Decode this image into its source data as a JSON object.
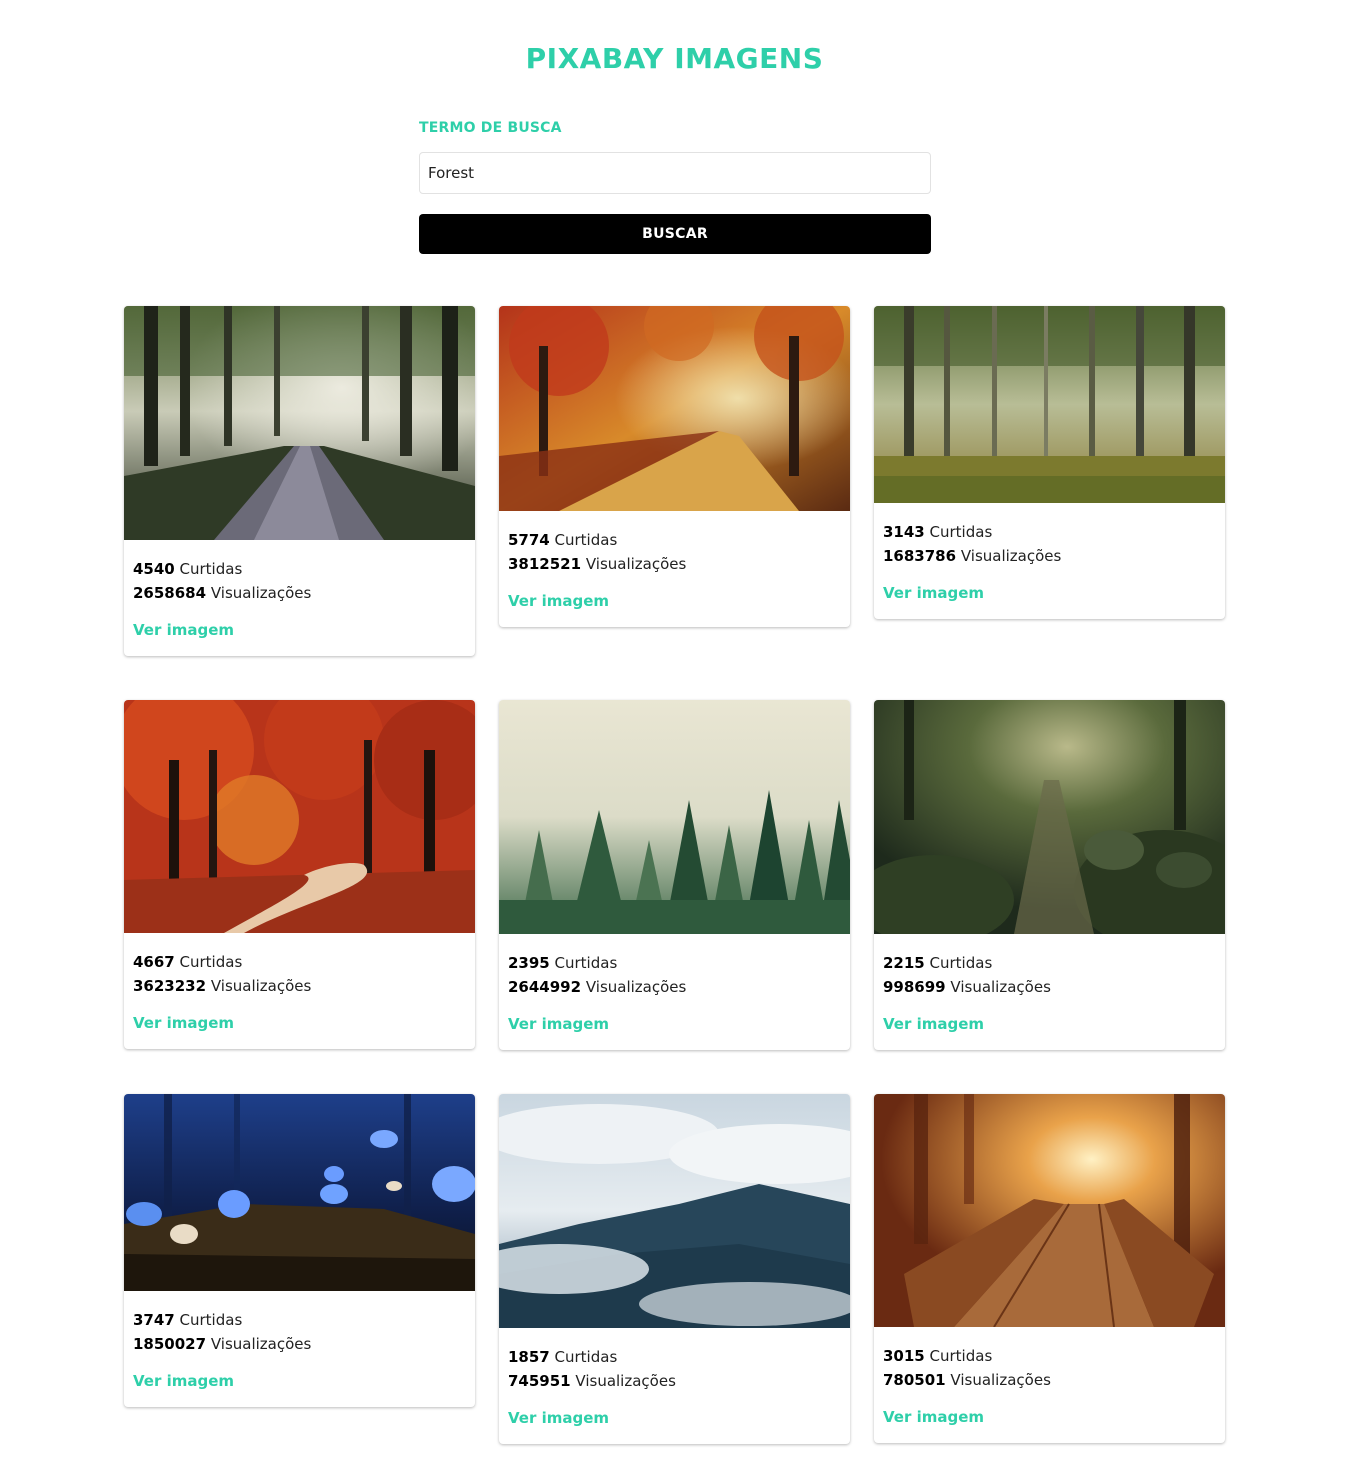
{
  "header": {
    "title": "PIXABAY IMAGENS"
  },
  "search": {
    "label": "TERMO DE BUSCA",
    "value": "Forest",
    "button_label": "BUSCAR"
  },
  "colors": {
    "accent": "#2ecfa9",
    "button": "#000000"
  },
  "cards": [
    {
      "likes": "4540",
      "likes_label": "Curtidas",
      "views": "2658684",
      "views_label": "Visualizações",
      "link": "Ver imagem",
      "scene": "sunbeam-road"
    },
    {
      "likes": "5774",
      "likes_label": "Curtidas",
      "views": "3812521",
      "views_label": "Visualizações",
      "link": "Ver imagem",
      "scene": "autumn-path"
    },
    {
      "likes": "3143",
      "likes_label": "Curtidas",
      "views": "1683786",
      "views_label": "Visualizações",
      "link": "Ver imagem",
      "scene": "green-forest"
    },
    {
      "likes": "4667",
      "likes_label": "Curtidas",
      "views": "3623232",
      "views_label": "Visualizações",
      "link": "Ver imagem",
      "scene": "red-autumn-road"
    },
    {
      "likes": "2395",
      "likes_label": "Curtidas",
      "views": "2644992",
      "views_label": "Visualizações",
      "link": "Ver imagem",
      "scene": "misty-pines"
    },
    {
      "likes": "2215",
      "likes_label": "Curtidas",
      "views": "998699",
      "views_label": "Visualizações",
      "link": "Ver imagem",
      "scene": "mossy-trail"
    },
    {
      "likes": "3747",
      "likes_label": "Curtidas",
      "views": "1850027",
      "views_label": "Visualizações",
      "link": "Ver imagem",
      "scene": "blue-butterflies"
    },
    {
      "likes": "1857",
      "likes_label": "Curtidas",
      "views": "745951",
      "views_label": "Visualizações",
      "link": "Ver imagem",
      "scene": "foggy-mountain"
    },
    {
      "likes": "3015",
      "likes_label": "Curtidas",
      "views": "780501",
      "views_label": "Visualizações",
      "link": "Ver imagem",
      "scene": "golden-bridge"
    }
  ]
}
